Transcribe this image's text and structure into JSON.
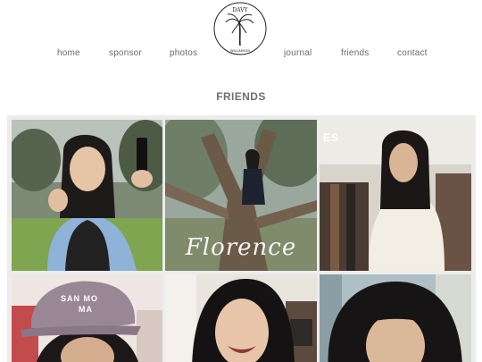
{
  "nav": {
    "items": [
      "home",
      "sponsor",
      "photos",
      "journal",
      "friends",
      "contact"
    ]
  },
  "logo": {
    "line1": "DAVY",
    "line2": "WILLIAMSON"
  },
  "page": {
    "title": "FRIENDS"
  },
  "gallery": {
    "caption": "Florence",
    "cap_text_1": "SAN MO",
    "cap_text_2": "MA",
    "store_sign": "ES"
  },
  "colors": {
    "nav_text": "#6b6b6b",
    "title_text": "#6f6f6f",
    "gallery_bg": "#ececec"
  }
}
